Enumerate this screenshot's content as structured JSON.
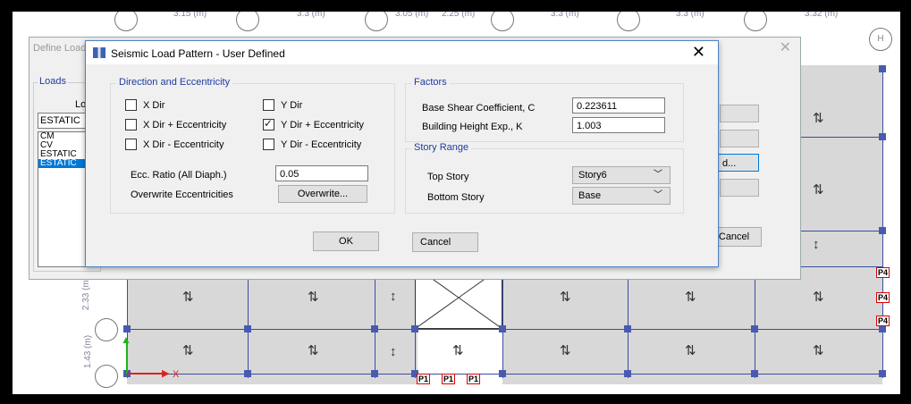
{
  "plan": {
    "dims_top": [
      "3.15 (m)",
      "3.3 (m)",
      "3.05 (m)",
      "2.25 (m)",
      "3.3 (m)",
      "3.3 (m)",
      "3.32 (m)"
    ],
    "dims_left": [
      "2.33 (m)",
      "1.43 (m)"
    ],
    "bubble_label": "H",
    "axis_x": "X",
    "pier_tags_bottom": [
      "P1",
      "P1",
      "P1"
    ],
    "pier_tags_right": [
      "P4",
      "P4",
      "P4"
    ]
  },
  "back_dialog": {
    "title": "Define Load",
    "group_label": "Loads",
    "header": "Loa",
    "field_value": "ESTATIC",
    "list": [
      "CM",
      "CV",
      "ESTATIC",
      "ESTATIC"
    ],
    "selected_index": 3,
    "modify_label": "d...",
    "cancel_label": "Cancel"
  },
  "dialog": {
    "title": "Seismic Load Pattern - User Defined",
    "close": "✕",
    "direction": {
      "label": "Direction and Eccentricity",
      "options": [
        {
          "label": "X Dir",
          "checked": false
        },
        {
          "label": "Y Dir",
          "checked": false
        },
        {
          "label": "X Dir + Eccentricity",
          "checked": false
        },
        {
          "label": "Y Dir + Eccentricity",
          "checked": true
        },
        {
          "label": "X Dir - Eccentricity",
          "checked": false
        },
        {
          "label": "Y Dir - Eccentricity",
          "checked": false
        }
      ],
      "ecc_ratio_label": "Ecc. Ratio (All Diaph.)",
      "ecc_ratio_value": "0.05",
      "overwrite_label": "Overwrite Eccentricities",
      "overwrite_button": "Overwrite..."
    },
    "factors": {
      "label": "Factors",
      "base_shear_label": "Base Shear Coefficient, C",
      "base_shear_value": "0.223611",
      "height_exp_label": "Building Height Exp., K",
      "height_exp_value": "1.003"
    },
    "story_range": {
      "label": "Story Range",
      "top_label": "Top Story",
      "top_value": "Story6",
      "bottom_label": "Bottom Story",
      "bottom_value": "Base"
    },
    "ok_label": "OK",
    "cancel_label": "Cancel"
  }
}
